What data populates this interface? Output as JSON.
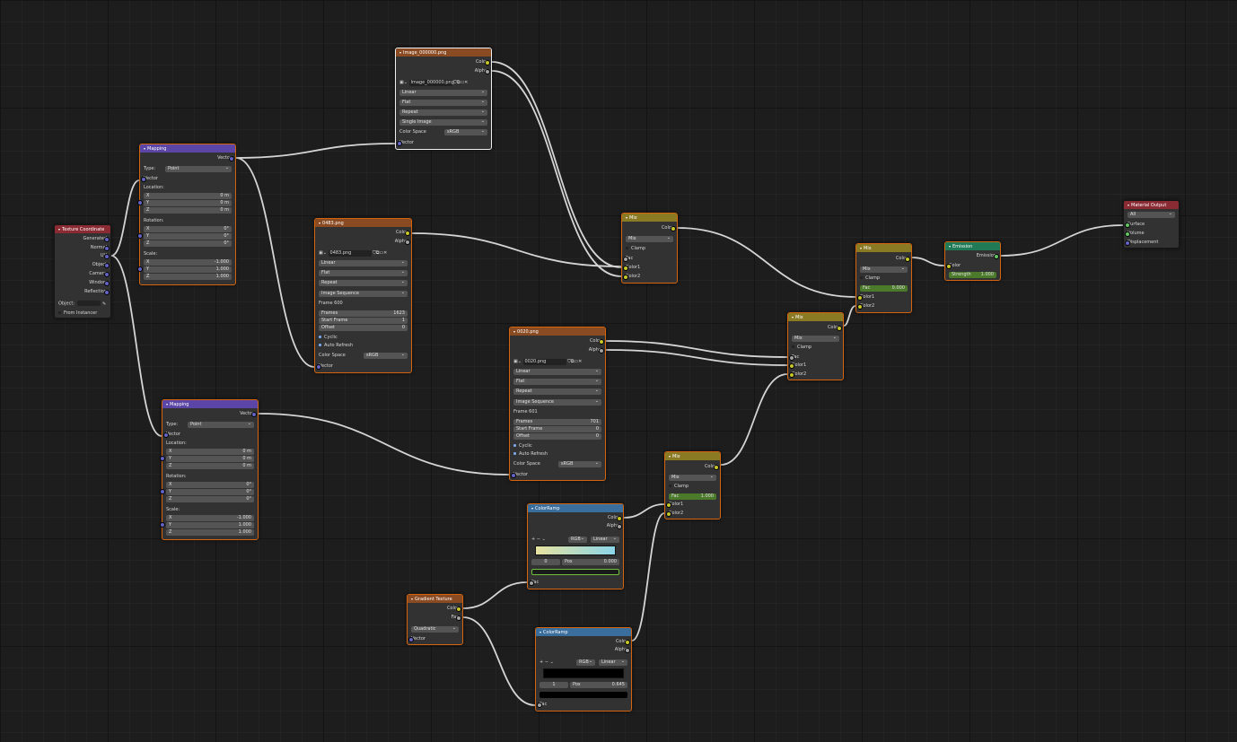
{
  "nodes": {
    "texcoord": {
      "title": "Texture Coordinate",
      "outputs": [
        "Generated",
        "Normal",
        "UV",
        "Object",
        "Camera",
        "Window",
        "Reflection"
      ],
      "object_label": "Object:",
      "from_instancer": "From Instancer"
    },
    "mapping1": {
      "title": "Mapping",
      "out": "Vector",
      "type_label": "Type:",
      "type_value": "Point",
      "vector_in": "Vector",
      "location_label": "Location:",
      "location": [
        {
          "axis": "X",
          "value": "0 m"
        },
        {
          "axis": "Y",
          "value": "0 m"
        },
        {
          "axis": "Z",
          "value": "0 m"
        }
      ],
      "rotation_label": "Rotation:",
      "rotation": [
        {
          "axis": "X",
          "value": "0°"
        },
        {
          "axis": "Y",
          "value": "0°"
        },
        {
          "axis": "Z",
          "value": "0°"
        }
      ],
      "scale_label": "Scale:",
      "scale": [
        {
          "axis": "X",
          "value": "-1.000"
        },
        {
          "axis": "Y",
          "value": "1.000"
        },
        {
          "axis": "Z",
          "value": "1.000"
        }
      ]
    },
    "mapping2": {
      "title": "Mapping",
      "out": "Vector",
      "type_label": "Type:",
      "type_value": "Point",
      "vector_in": "Vector",
      "location_label": "Location:",
      "location": [
        {
          "axis": "X",
          "value": "0 m"
        },
        {
          "axis": "Y",
          "value": "0 m"
        },
        {
          "axis": "Z",
          "value": "0 m"
        }
      ],
      "rotation_label": "Rotation:",
      "rotation": [
        {
          "axis": "X",
          "value": "0°"
        },
        {
          "axis": "Y",
          "value": "0°"
        },
        {
          "axis": "Z",
          "value": "0°"
        }
      ],
      "scale_label": "Scale:",
      "scale": [
        {
          "axis": "X",
          "value": "-1.000"
        },
        {
          "axis": "Y",
          "value": "1.000"
        },
        {
          "axis": "Z",
          "value": "1.000"
        }
      ]
    },
    "img1": {
      "title": "Image_000000.png",
      "out_color": "Color",
      "out_alpha": "Alpha",
      "image": "Image_000000.png",
      "interp": "Linear",
      "proj": "Flat",
      "ext": "Repeat",
      "source": "Single Image",
      "cs_label": "Color Space",
      "cs_value": "sRGB",
      "vector_in": "Vector"
    },
    "img2": {
      "title": "0483.png",
      "out_color": "Color",
      "out_alpha": "Alpha",
      "image": "0483.png",
      "interp": "Linear",
      "proj": "Flat",
      "ext": "Repeat",
      "source": "Image Sequence",
      "frame": "Frame 600",
      "frames_label": "Frames",
      "frames_value": "1623",
      "start_label": "Start Frame",
      "start_value": "1",
      "offset_label": "Offset",
      "offset_value": "0",
      "cyclic": "Cyclic",
      "auto_refresh": "Auto Refresh",
      "cs_label": "Color Space",
      "cs_value": "sRGB",
      "vector_in": "Vector"
    },
    "img3": {
      "title": "0020.png",
      "out_color": "Color",
      "out_alpha": "Alpha",
      "image": "0020.png",
      "interp": "Linear",
      "proj": "Flat",
      "ext": "Repeat",
      "source": "Image Sequence",
      "frame": "Frame 601",
      "frames_label": "Frames",
      "frames_value": "701",
      "start_label": "Start Frame",
      "start_value": "0",
      "offset_label": "Offset",
      "offset_value": "0",
      "cyclic": "Cyclic",
      "auto_refresh": "Auto Refresh",
      "cs_label": "Color Space",
      "cs_value": "sRGB",
      "vector_in": "Vector"
    },
    "mix1": {
      "title": "Mix",
      "out": "Color",
      "blend": "Mix",
      "clamp": "Clamp",
      "fac": "Fac",
      "c1": "Color1",
      "c2": "Color2"
    },
    "mix2": {
      "title": "Mix",
      "out": "Color",
      "blend": "Mix",
      "clamp": "Clamp",
      "fac_label": "Fac",
      "fac_value": "0.000",
      "c1": "Color1",
      "c2": "Color2"
    },
    "mix3": {
      "title": "Mix",
      "out": "Color",
      "blend": "Mix",
      "clamp": "Clamp",
      "fac": "Fac",
      "c1": "Color1",
      "c2": "Color2"
    },
    "mix4": {
      "title": "Mix",
      "out": "Color",
      "blend": "Mix",
      "clamp": "Clamp",
      "fac_label": "Fac",
      "fac_value": "1.000",
      "c1": "Color1",
      "c2": "Color2"
    },
    "emission": {
      "title": "Emission",
      "out": "Emission",
      "color": "Color",
      "strength_label": "Strength",
      "strength_value": "1.000"
    },
    "output": {
      "title": "Material Output",
      "target": "All",
      "surface": "Surface",
      "volume": "Volume",
      "displacement": "Displacement"
    },
    "ramp1": {
      "title": "ColorRamp",
      "out_color": "Color",
      "out_alpha": "Alpha",
      "mode": "RGB",
      "interp": "Linear",
      "index": "0",
      "pos_label": "Pos",
      "pos_value": "0.000",
      "fac": "Fac"
    },
    "ramp2": {
      "title": "ColorRamp",
      "out_color": "Color",
      "out_alpha": "Alpha",
      "mode": "RGB",
      "interp": "Linear",
      "index": "1",
      "pos_label": "Pos",
      "pos_value": "0.645",
      "fac": "Fac"
    },
    "gradient": {
      "title": "Gradient Texture",
      "out_color": "Color",
      "out_fac": "Fac",
      "type": "Quadratic",
      "vector_in": "Vector"
    }
  },
  "colors": {
    "texture_header": "#8a4a22",
    "vector_header": "#5b45a6",
    "input_header": "#8a2a33",
    "color_header": "#8a7a24",
    "shader_header": "#1f7a55",
    "converter_header": "#3a6e9c",
    "socket_color": "#c7c729",
    "socket_vector": "#6363c7",
    "socket_shader": "#63c763",
    "selected_outline": "#d4650e"
  }
}
